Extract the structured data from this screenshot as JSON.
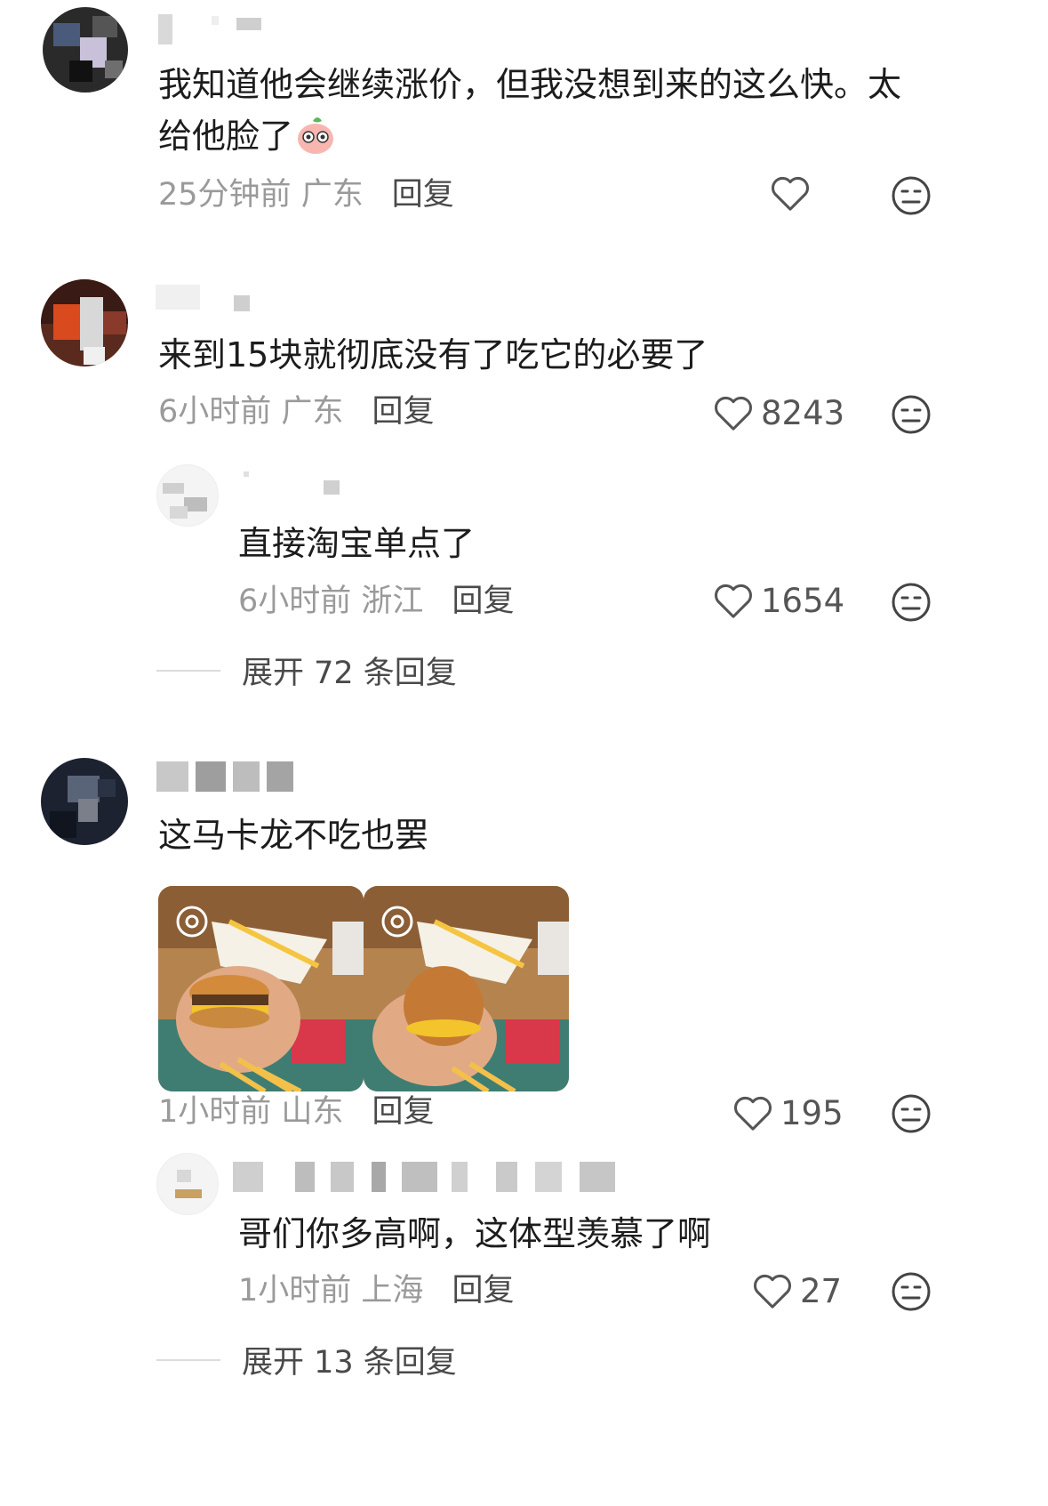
{
  "comments": [
    {
      "text_line1": "我知道他会继续涨价，但我没想到来的这么快。太",
      "text_line2": "给他脸了",
      "time": "25分钟前",
      "location": "广东",
      "reply_label": "回复",
      "likes": ""
    },
    {
      "text": "来到15块就彻底没有了吃它的必要了",
      "time": "6小时前",
      "location": "广东",
      "reply_label": "回复",
      "likes": "8243",
      "sub_reply": {
        "text": "直接淘宝单点了",
        "time": "6小时前",
        "location": "浙江",
        "reply_label": "回复",
        "likes": "1654"
      },
      "expand_label": "展开 72 条回复"
    },
    {
      "text": "这马卡龙不吃也罢",
      "time": "1小时前",
      "location": "山东",
      "reply_label": "回复",
      "likes": "195",
      "sub_reply": {
        "text": "哥们你多高啊，这体型羡慕了啊",
        "time": "1小时前",
        "location": "上海",
        "reply_label": "回复",
        "likes": "27"
      },
      "expand_label": "展开 13 条回复"
    }
  ],
  "icons": {
    "like": "heart-outline-icon",
    "dislike": "meh-face-icon",
    "emoji": "pink-blob-emoji-icon"
  },
  "colors": {
    "meta_gray": "#9a9a9a",
    "text": "#1c1c1c"
  }
}
